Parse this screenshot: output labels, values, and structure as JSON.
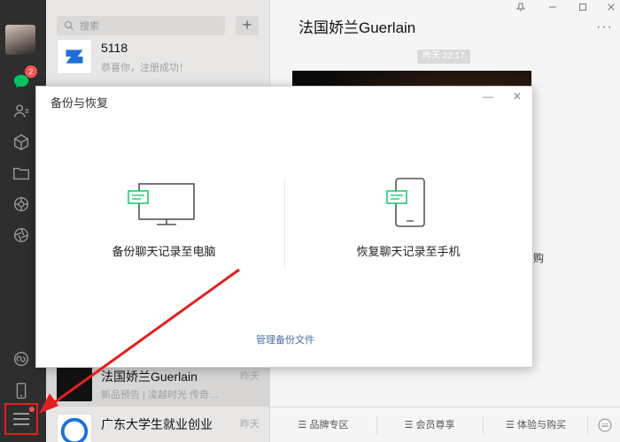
{
  "nav": {
    "chat_badge": "2",
    "icons": [
      "chat-icon",
      "contacts-icon",
      "favorites-icon",
      "files-icon",
      "moments-icon",
      "channels-icon",
      "mini-program-icon",
      "phone-icon",
      "menu-icon"
    ]
  },
  "list": {
    "search_placeholder": "搜索",
    "add_label": "+",
    "items": [
      {
        "name": "5118",
        "sub": "恭喜你，注册成功！",
        "time": ""
      },
      {
        "name": "法国娇兰Guerlain",
        "sub": "新品预告 | 凌越时光 传奇…",
        "time": "昨天"
      },
      {
        "name": "广东大学生就业创业",
        "sub": "",
        "time": "昨天"
      }
    ]
  },
  "main": {
    "title": "法国娇兰Guerlain",
    "more": "···",
    "time_chip": "昨天 22:17",
    "article_row2_text": "购",
    "bottom_bar": [
      "品牌专区",
      "会员尊享",
      "体验与购买"
    ],
    "window_controls": [
      "pin-icon",
      "minimize-icon",
      "maximize-icon",
      "close-icon"
    ]
  },
  "dialog": {
    "title": "备份与恢复",
    "minimize": "—",
    "close": "✕",
    "backup_label": "备份聊天记录至电脑",
    "restore_label": "恢复聊天记录至手机",
    "manage_link": "管理备份文件"
  },
  "colors": {
    "nav_bg": "#2e2e2e",
    "badge": "#fa5151",
    "wechat_green": "#07c160",
    "annotation_red": "#e02020",
    "link_blue": "#4a6da7"
  }
}
